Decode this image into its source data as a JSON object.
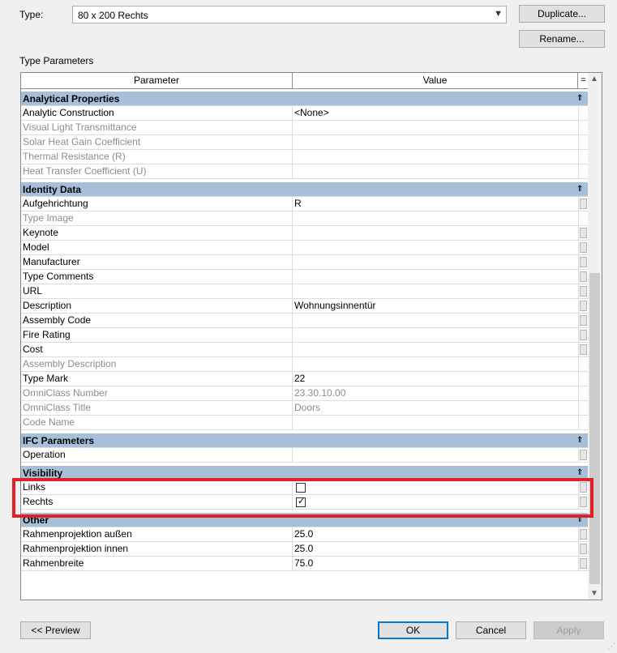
{
  "type_row": {
    "label": "Type:",
    "selected": "80 x 200 Rechts",
    "duplicate_label": "Duplicate...",
    "rename_label": "Rename..."
  },
  "section_title": "Type Parameters",
  "grid": {
    "col_parameter": "Parameter",
    "col_value": "Value",
    "col_menu": "=",
    "collapse_icon": "⇑"
  },
  "groups": {
    "analytical": {
      "title": "Analytical Properties",
      "rows": [
        {
          "param": "Analytic Construction",
          "value": "<None>"
        },
        {
          "param": "Visual Light Transmittance",
          "value": ""
        },
        {
          "param": "Solar Heat Gain Coefficient",
          "value": ""
        },
        {
          "param": "Thermal Resistance (R)",
          "value": ""
        },
        {
          "param": "Heat Transfer Coefficient (U)",
          "value": ""
        }
      ]
    },
    "identity": {
      "title": "Identity Data",
      "rows": [
        {
          "param": "Aufgehrichtung",
          "value": "R"
        },
        {
          "param": "Type Image",
          "value": ""
        },
        {
          "param": "Keynote",
          "value": ""
        },
        {
          "param": "Model",
          "value": ""
        },
        {
          "param": "Manufacturer",
          "value": ""
        },
        {
          "param": "Type Comments",
          "value": ""
        },
        {
          "param": "URL",
          "value": ""
        },
        {
          "param": "Description",
          "value": "Wohnungsinnentür"
        },
        {
          "param": "Assembly Code",
          "value": ""
        },
        {
          "param": "Fire Rating",
          "value": ""
        },
        {
          "param": "Cost",
          "value": ""
        },
        {
          "param": "Assembly Description",
          "value": ""
        },
        {
          "param": "Type Mark",
          "value": "22"
        },
        {
          "param": "OmniClass Number",
          "value": "23.30.10.00"
        },
        {
          "param": "OmniClass Title",
          "value": "Doors"
        },
        {
          "param": "Code Name",
          "value": ""
        }
      ]
    },
    "ifc": {
      "title": "IFC Parameters",
      "rows": [
        {
          "param": "Operation",
          "value": ""
        }
      ]
    },
    "visibility": {
      "title": "Visibility",
      "rows": [
        {
          "param": "Links",
          "checked": false
        },
        {
          "param": "Rechts",
          "checked": true
        }
      ]
    },
    "other": {
      "title": "Other",
      "rows": [
        {
          "param": "Rahmenprojektion außen",
          "value": "25.0"
        },
        {
          "param": "Rahmenprojektion innen",
          "value": "25.0"
        },
        {
          "param": "Rahmenbreite",
          "value": "75.0"
        }
      ]
    }
  },
  "footer": {
    "preview_label": "<< Preview",
    "ok_label": "OK",
    "cancel_label": "Cancel",
    "apply_label": "Apply"
  },
  "colors": {
    "group_header": "#a7c0da",
    "highlight_border": "#e32028",
    "ok_border": "#0078d7"
  }
}
